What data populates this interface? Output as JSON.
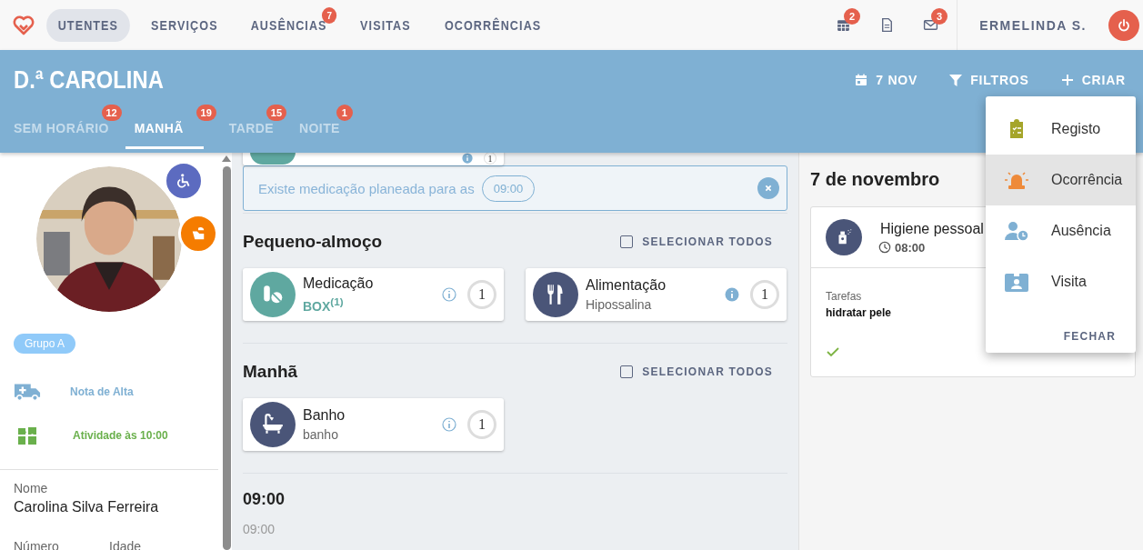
{
  "nav": {
    "items": [
      {
        "label": "UTENTES",
        "selected": true
      },
      {
        "label": "SERVIÇOS",
        "selected": false
      },
      {
        "label": "AUSÊNCIAS",
        "selected": false,
        "badge": "7"
      },
      {
        "label": "VISITAS",
        "selected": false
      },
      {
        "label": "OCORRÊNCIAS",
        "selected": false
      }
    ],
    "tools": [
      {
        "kind": "calendar",
        "badge": "2"
      },
      {
        "kind": "document"
      },
      {
        "kind": "mail",
        "badge": "3"
      }
    ],
    "user": "ERMELINDA S."
  },
  "header": {
    "title": "D.ª CAROLINA",
    "actions": [
      {
        "kind": "date",
        "label": "7 NOV"
      },
      {
        "kind": "filter",
        "label": "FILTROS"
      },
      {
        "kind": "create",
        "label": "CRIAR"
      }
    ],
    "shifts": [
      {
        "label": "SEM HORÁRIO",
        "badge": "12",
        "selected": false
      },
      {
        "label": "MANHÃ",
        "badge": "19",
        "selected": true
      },
      {
        "label": "TARDE",
        "badge": "15",
        "selected": false
      },
      {
        "label": "NOITE",
        "badge": "1",
        "selected": false
      }
    ]
  },
  "profile": {
    "group": "Grupo A",
    "notes": [
      {
        "kind": "discharge",
        "text": "Nota de Alta",
        "color": "#7fb0d3"
      },
      {
        "kind": "activity",
        "text": "Atividade às 10:00",
        "color": "#6ab04c"
      }
    ],
    "name_label": "Nome",
    "name": "Carolina Silva Ferreira",
    "labels": [
      "Número",
      "Idade"
    ]
  },
  "plan": {
    "partial_count": "1",
    "alert": {
      "text": "Existe medicação planeada para as",
      "time": "09:00"
    },
    "sections": [
      {
        "kind": "group",
        "title": "Pequeno-almoço",
        "select_all": "SELECIONAR TODOS",
        "checked": false,
        "cards": [
          {
            "kind": "medication",
            "title": "Medicação",
            "subtitle": "BOX$^{(1)}$",
            "subtitle_emphasis": true,
            "info_filled": false,
            "count": "1"
          },
          {
            "kind": "meal",
            "title": "Alimentação",
            "subtitle": "Hipossalina",
            "subtitle_emphasis": false,
            "info_filled": true,
            "count": "1"
          }
        ]
      },
      {
        "kind": "group",
        "title": "Manhã",
        "select_all": "SELECIONAR TODOS",
        "checked": false,
        "cards": [
          {
            "kind": "bath",
            "title": "Banho",
            "subtitle": "banho",
            "subtitle_emphasis": false,
            "info_filled": false,
            "count": "1"
          }
        ]
      },
      {
        "kind": "time",
        "title": "09:00",
        "entries": [
          "09:00"
        ]
      }
    ]
  },
  "day": {
    "title": "7 de novembro",
    "cards": [
      {
        "kind": "hygiene",
        "title": "Higiene pessoal",
        "time": "08:00",
        "tasks_label": "Tarefas",
        "tasks": "hidratar pele",
        "done": true
      }
    ]
  },
  "menu": {
    "items": [
      {
        "kind": "record",
        "label": "Registo",
        "selected": false
      },
      {
        "kind": "incident",
        "label": "Ocorrência",
        "selected": true
      },
      {
        "kind": "absence",
        "label": "Ausência",
        "selected": false
      },
      {
        "kind": "visit",
        "label": "Visita",
        "selected": false
      }
    ],
    "close": "FECHAR"
  }
}
